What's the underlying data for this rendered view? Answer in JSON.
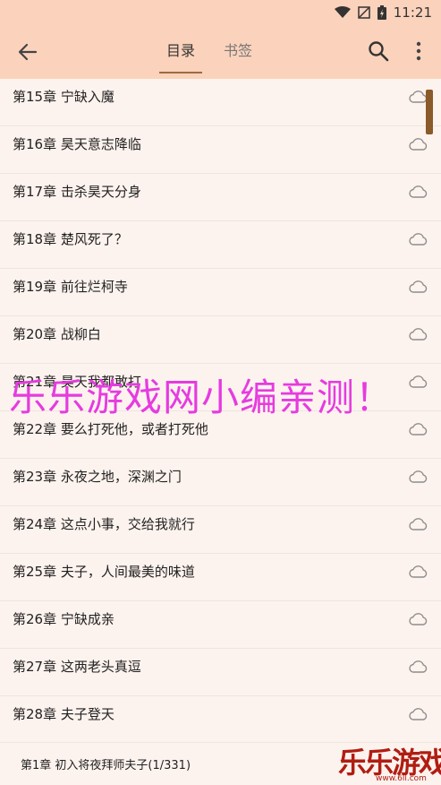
{
  "status_bar": {
    "time": "11:21"
  },
  "header": {
    "tabs": [
      {
        "label": "目录",
        "active": true
      },
      {
        "label": "书签",
        "active": false
      }
    ]
  },
  "chapters": [
    {
      "title": "第15章 宁缺入魔"
    },
    {
      "title": "第16章 昊天意志降临"
    },
    {
      "title": "第17章 击杀昊天分身"
    },
    {
      "title": "第18章 楚风死了？"
    },
    {
      "title": "第19章 前往烂柯寺"
    },
    {
      "title": "第20章 战柳白"
    },
    {
      "title": "第21章 昊天我都敢打"
    },
    {
      "title": "第22章 要么打死他，或者打死他"
    },
    {
      "title": "第23章 永夜之地，深渊之门"
    },
    {
      "title": "第24章 这点小事，交给我就行"
    },
    {
      "title": "第25章 夫子，人间最美的味道"
    },
    {
      "title": "第26章 宁缺成亲"
    },
    {
      "title": "第27章 这两老头真逗"
    },
    {
      "title": "第28章 夫子登天"
    }
  ],
  "watermark": "乐乐游戏网小编亲测！",
  "footer": {
    "current_chapter": "第1章 初入将夜拜师夫子(1/331)"
  },
  "logo": {
    "text": "乐乐游戏",
    "url": "www.6ll.com"
  },
  "colors": {
    "header_bg": "#fbd2bb",
    "page_bg": "#fdf3ee",
    "accent": "#8a5a2b",
    "watermark": "#e63be0"
  }
}
